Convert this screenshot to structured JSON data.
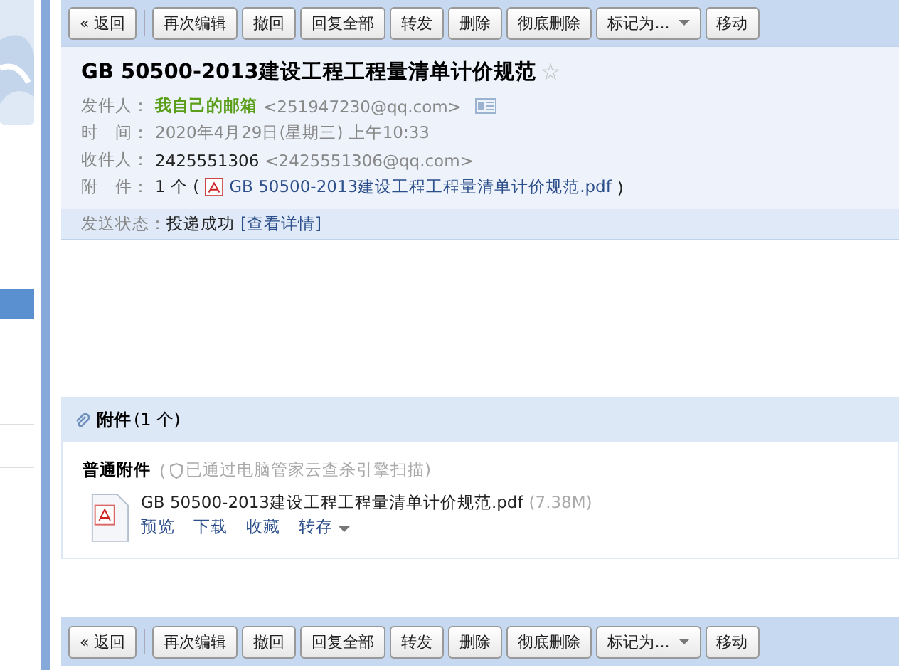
{
  "toolbar_top": [
    "« 返回",
    "再次编辑",
    "撤回",
    "回复全部",
    "转发",
    "删除",
    "彻底删除",
    "标记为...",
    "移动"
  ],
  "mail": {
    "subject": "GB 50500-2013建设工程工程量清单计价规范",
    "star": "☆",
    "from_label": "发件人：",
    "from_name": "我自己的邮箱",
    "from_addr": "<251947230@qq.com>",
    "time_label": "时　间：",
    "time": "2020年4月29日(星期三) 上午10:33",
    "to_label": "收件人：",
    "to_name": "2425551306",
    "to_addr": "<2425551306@qq.com>",
    "att_label": "附　件：",
    "att_count": "1 个 (",
    "att_name": "GB 50500-2013建设工程工程量清单计价规范.pdf",
    "att_close": ")",
    "status_label": "发送状态：",
    "status": "投递成功",
    "status_link": "[查看详情]"
  },
  "attachments": {
    "title": "附件",
    "count": "(1 个)",
    "group": "普通附件",
    "scan_open": "(",
    "scan": "已通过电脑管家云查杀引擎扫描)",
    "files": [
      {
        "name": "GB 50500-2013建设工程工程量清单计价规范.pdf",
        "size": "(7.38M)",
        "actions": [
          "预览",
          "下载",
          "收藏"
        ],
        "menu": "转存"
      }
    ]
  },
  "toolbar_bottom": [
    "« 返回",
    "再次编辑",
    "撤回",
    "回复全部",
    "转发",
    "删除",
    "彻底删除",
    "标记为...",
    "移动"
  ]
}
